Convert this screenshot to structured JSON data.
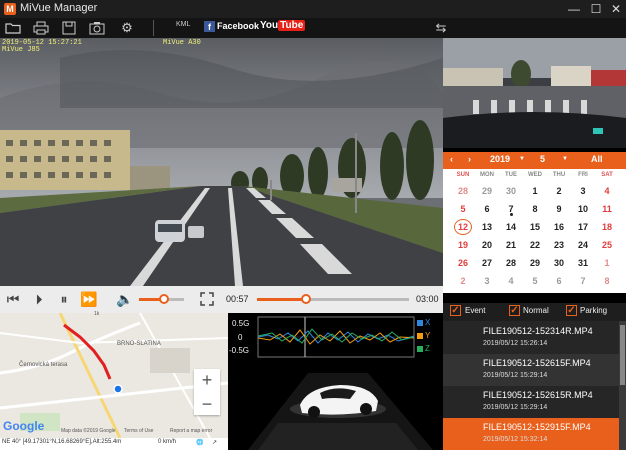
{
  "window": {
    "title": "MiVue Manager"
  },
  "toolbar": {
    "kml": "KML",
    "facebook": "Facebook",
    "youtube_you": "You",
    "youtube_tube": "Tube"
  },
  "video": {
    "stamp_datetime": "2019-05-12  15:27:21",
    "stamp_model": "MiVue A30",
    "stamp_product": "MiVue J85"
  },
  "calendar": {
    "year": "2019",
    "month": "5",
    "all_label": "All",
    "weekdays": [
      "SUN",
      "MON",
      "TUE",
      "WED",
      "THU",
      "FRI",
      "SAT"
    ],
    "weeks": [
      [
        "28",
        "29",
        "30",
        "1",
        "2",
        "3",
        "4"
      ],
      [
        "5",
        "6",
        "7",
        "8",
        "9",
        "10",
        "11"
      ],
      [
        "12",
        "13",
        "14",
        "15",
        "16",
        "17",
        "18"
      ],
      [
        "19",
        "20",
        "21",
        "22",
        "23",
        "24",
        "25"
      ],
      [
        "26",
        "27",
        "28",
        "29",
        "30",
        "31",
        "1"
      ],
      [
        "2",
        "3",
        "4",
        "5",
        "6",
        "7",
        "8"
      ]
    ],
    "selected_day": "12"
  },
  "player": {
    "current_time": "00:57",
    "total_time": "03:00",
    "progress": 0.32,
    "volume": 0.55
  },
  "filters": {
    "event": "Event",
    "normal": "Normal",
    "parking": "Parking"
  },
  "map": {
    "place_city": "BRNO-SLATINA",
    "place_street": "Černovická terasa",
    "zoom_in": "+",
    "zoom_out": "−",
    "google": "Google",
    "map_data": "Map data ©2019 Google",
    "terms": "Terms of Use",
    "report": "Report a map error",
    "scale": "1k",
    "coords": "NE 40° [49.17301°N,16.68269°E],Alt:255.4m",
    "speed": "0   km/h"
  },
  "gsensor": {
    "label_pos": "0.5G",
    "label_zero": "0",
    "label_neg": "-0.5G",
    "axis_x": "X",
    "axis_y": "Y",
    "axis_z": "Z"
  },
  "files": [
    {
      "name": "FILE190512-152314R.MP4",
      "time": "2019/05/12    15:26:14",
      "selected": false
    },
    {
      "name": "FILE190512-152615F.MP4",
      "time": "2019/05/12    15:29:14",
      "selected": false
    },
    {
      "name": "FILE190512-152615R.MP4",
      "time": "2019/05/12    15:29:14",
      "selected": false
    },
    {
      "name": "FILE190512-152915F.MP4",
      "time": "2019/05/12    15:32:14",
      "selected": true
    }
  ],
  "colors": {
    "accent": "#e8601c",
    "dark": "#1e1e1e",
    "route": "#e02020"
  }
}
